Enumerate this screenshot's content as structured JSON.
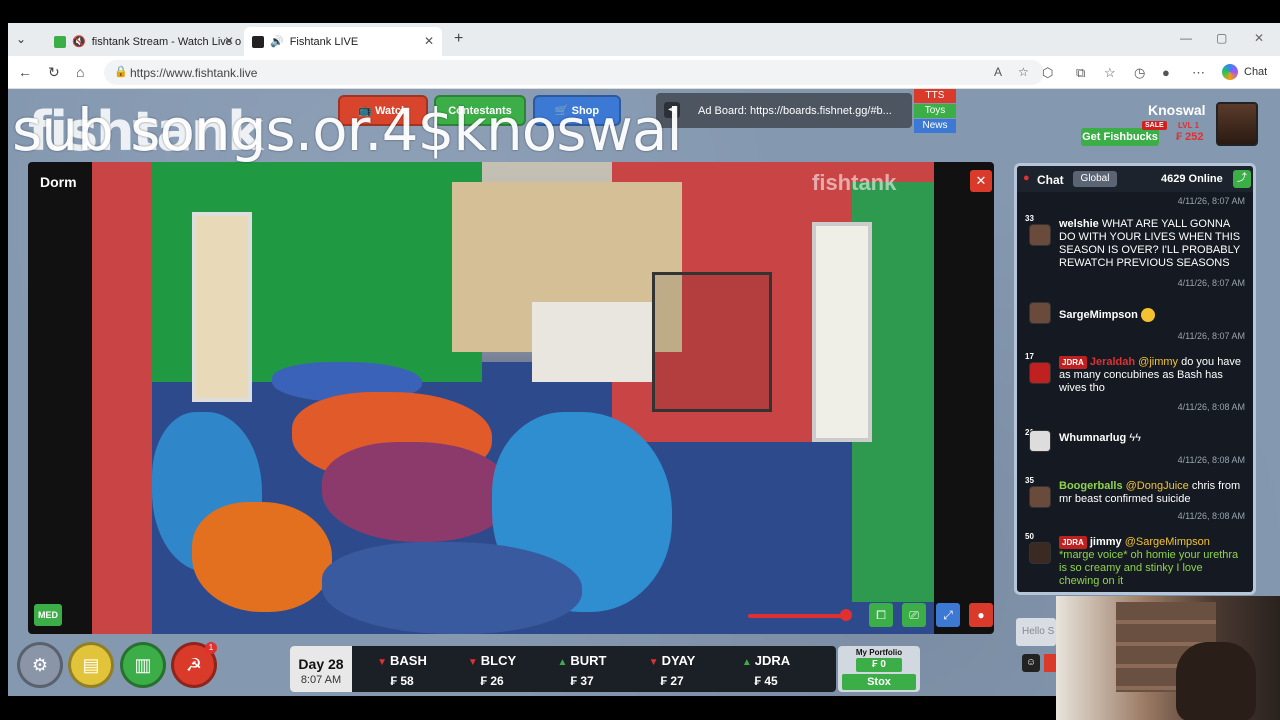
{
  "browser": {
    "tabs": [
      {
        "title": "fishtank Stream - Watch Live o"
      },
      {
        "title": "Fishtank LIVE"
      }
    ],
    "url": "https://www.fishtank.live",
    "chat_label": "Chat"
  },
  "overlay": {
    "text": "sub songs.or.4$knoswal",
    "logo": "fishtank"
  },
  "header": {
    "buttons": {
      "watch": "Watch",
      "contestants": "Contestants",
      "shop": "Shop"
    },
    "adboard": "Ad Board: https://boards.fishnet.gg/#b...",
    "side_tabs": [
      "TTS",
      "Toys",
      "News"
    ],
    "user": {
      "name": "Knoswal",
      "get_fishbucks": "Get Fishbucks",
      "sale": "SALE",
      "level": "LVL 1",
      "balance": "₣ 252"
    }
  },
  "video": {
    "room": "Dorm",
    "watermark": "fishtank",
    "quality": "MED"
  },
  "chat": {
    "title": "Chat",
    "channel": "Global",
    "online": "4629 Online",
    "messages": [
      {
        "time_before": "4/11/26, 8:07 AM",
        "level": "33",
        "user": "welshie",
        "tag": "",
        "text": "WHAT ARE YALL GONNA DO WITH YOUR LIVES WHEN THIS SEASON IS OVER? I'LL PROBABLY REWATCH PREVIOUS SEASONS",
        "mention": ""
      },
      {
        "time_before": "4/11/26, 8:07 AM",
        "level": "",
        "user": "SargeMimpson",
        "tag": "",
        "text": "",
        "mention": ""
      },
      {
        "time_before": "4/11/26, 8:07 AM",
        "level": "17",
        "user": "Jeraldah",
        "tag": "JDRA",
        "text": "do you have as many concubines as Bash has wives tho",
        "mention": "@jimmy"
      },
      {
        "time_before": "4/11/26, 8:08 AM",
        "level": "21",
        "user": "Whumnarlug",
        "tag": "",
        "text": "ϟϟ",
        "mention": ""
      },
      {
        "time_before": "4/11/26, 8:08 AM",
        "level": "35",
        "user": "Boogerballs",
        "tag": "",
        "text": "chris from mr beast confirmed suicide",
        "mention": "@DongJuice"
      },
      {
        "time_before": "4/11/26, 8:08 AM",
        "level": "50",
        "user": "jimmy",
        "tag": "JDRA",
        "text": "*marge voice* oh homie your urethra is so creamy and stinky I love chewing on it",
        "mention": "@SargeMimpson"
      }
    ],
    "input_placeholder": "Hello S"
  },
  "bottom": {
    "notif_count": "1",
    "day": "Day 28",
    "time": "8:07 AM",
    "stocks": [
      {
        "symbol": "BASH",
        "dir": "down",
        "price": "₣ 58"
      },
      {
        "symbol": "BLCY",
        "dir": "down",
        "price": "₣ 26"
      },
      {
        "symbol": "BURT",
        "dir": "up",
        "price": "₣ 37"
      },
      {
        "symbol": "DYAY",
        "dir": "down",
        "price": "₣ 27"
      },
      {
        "symbol": "JDRA",
        "dir": "up",
        "price": "₣ 45"
      }
    ],
    "portfolio_label": "My Portfolio",
    "portfolio_value": "₣ 0",
    "stox": "Stox"
  }
}
